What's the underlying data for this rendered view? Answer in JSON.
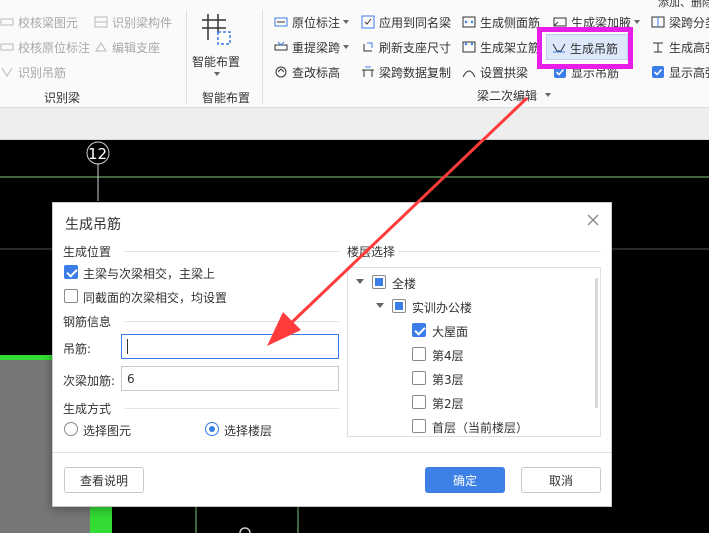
{
  "ribbon": {
    "group_beam_identify": {
      "label": "识别梁",
      "items": [
        "校核梁图元",
        "识别梁构件",
        "校核原位标注",
        "编辑支座",
        "识别吊筋"
      ]
    },
    "smart_layout": {
      "button_label": "智能布置",
      "group_label": "智能布置"
    },
    "beam_edit": {
      "group_label": "梁二次编辑",
      "col1": [
        "原位标注",
        "重提梁跨",
        "查改标高"
      ],
      "col2": [
        "应用到同名梁",
        "刷新支座尺寸",
        "梁跨数据复制"
      ],
      "col3": [
        "生成侧面筋",
        "生成架立筋",
        "设置拱梁"
      ],
      "col4": [
        "生成梁加腋",
        "生成吊筋",
        "显示吊筋"
      ],
      "col5": [
        "梁跨分类",
        "生成高强节点",
        "显示高强节点"
      ]
    },
    "highlight_color": "#e81ee8",
    "corner_text": "添加、删除"
  },
  "canvas": {
    "axis_label": "12"
  },
  "dialog": {
    "title": "生成吊筋",
    "position_section": "生成位置",
    "opt_main_secondary": "主梁与次梁相交，主梁上",
    "opt_same_section": "同截面的次梁相交，均设置",
    "rebar_section": "钢筋信息",
    "hanger_label": "吊筋:",
    "hanger_value": "",
    "secondary_label": "次梁加筋:",
    "secondary_value": "6",
    "method_section": "生成方式",
    "method_select_element": "选择图元",
    "method_select_floor": "选择楼层",
    "floor_section": "楼层选择",
    "tree": {
      "root": "全楼",
      "building": "实训办公楼",
      "floors": [
        "大屋面",
        "第4层",
        "第3层",
        "第2层",
        "首层（当前楼层）"
      ]
    },
    "help_button": "查看说明",
    "ok_button": "确定",
    "cancel_button": "取消"
  },
  "colors": {
    "accent": "#3d80e6",
    "annotation_arrow": "#ff3b3b"
  }
}
